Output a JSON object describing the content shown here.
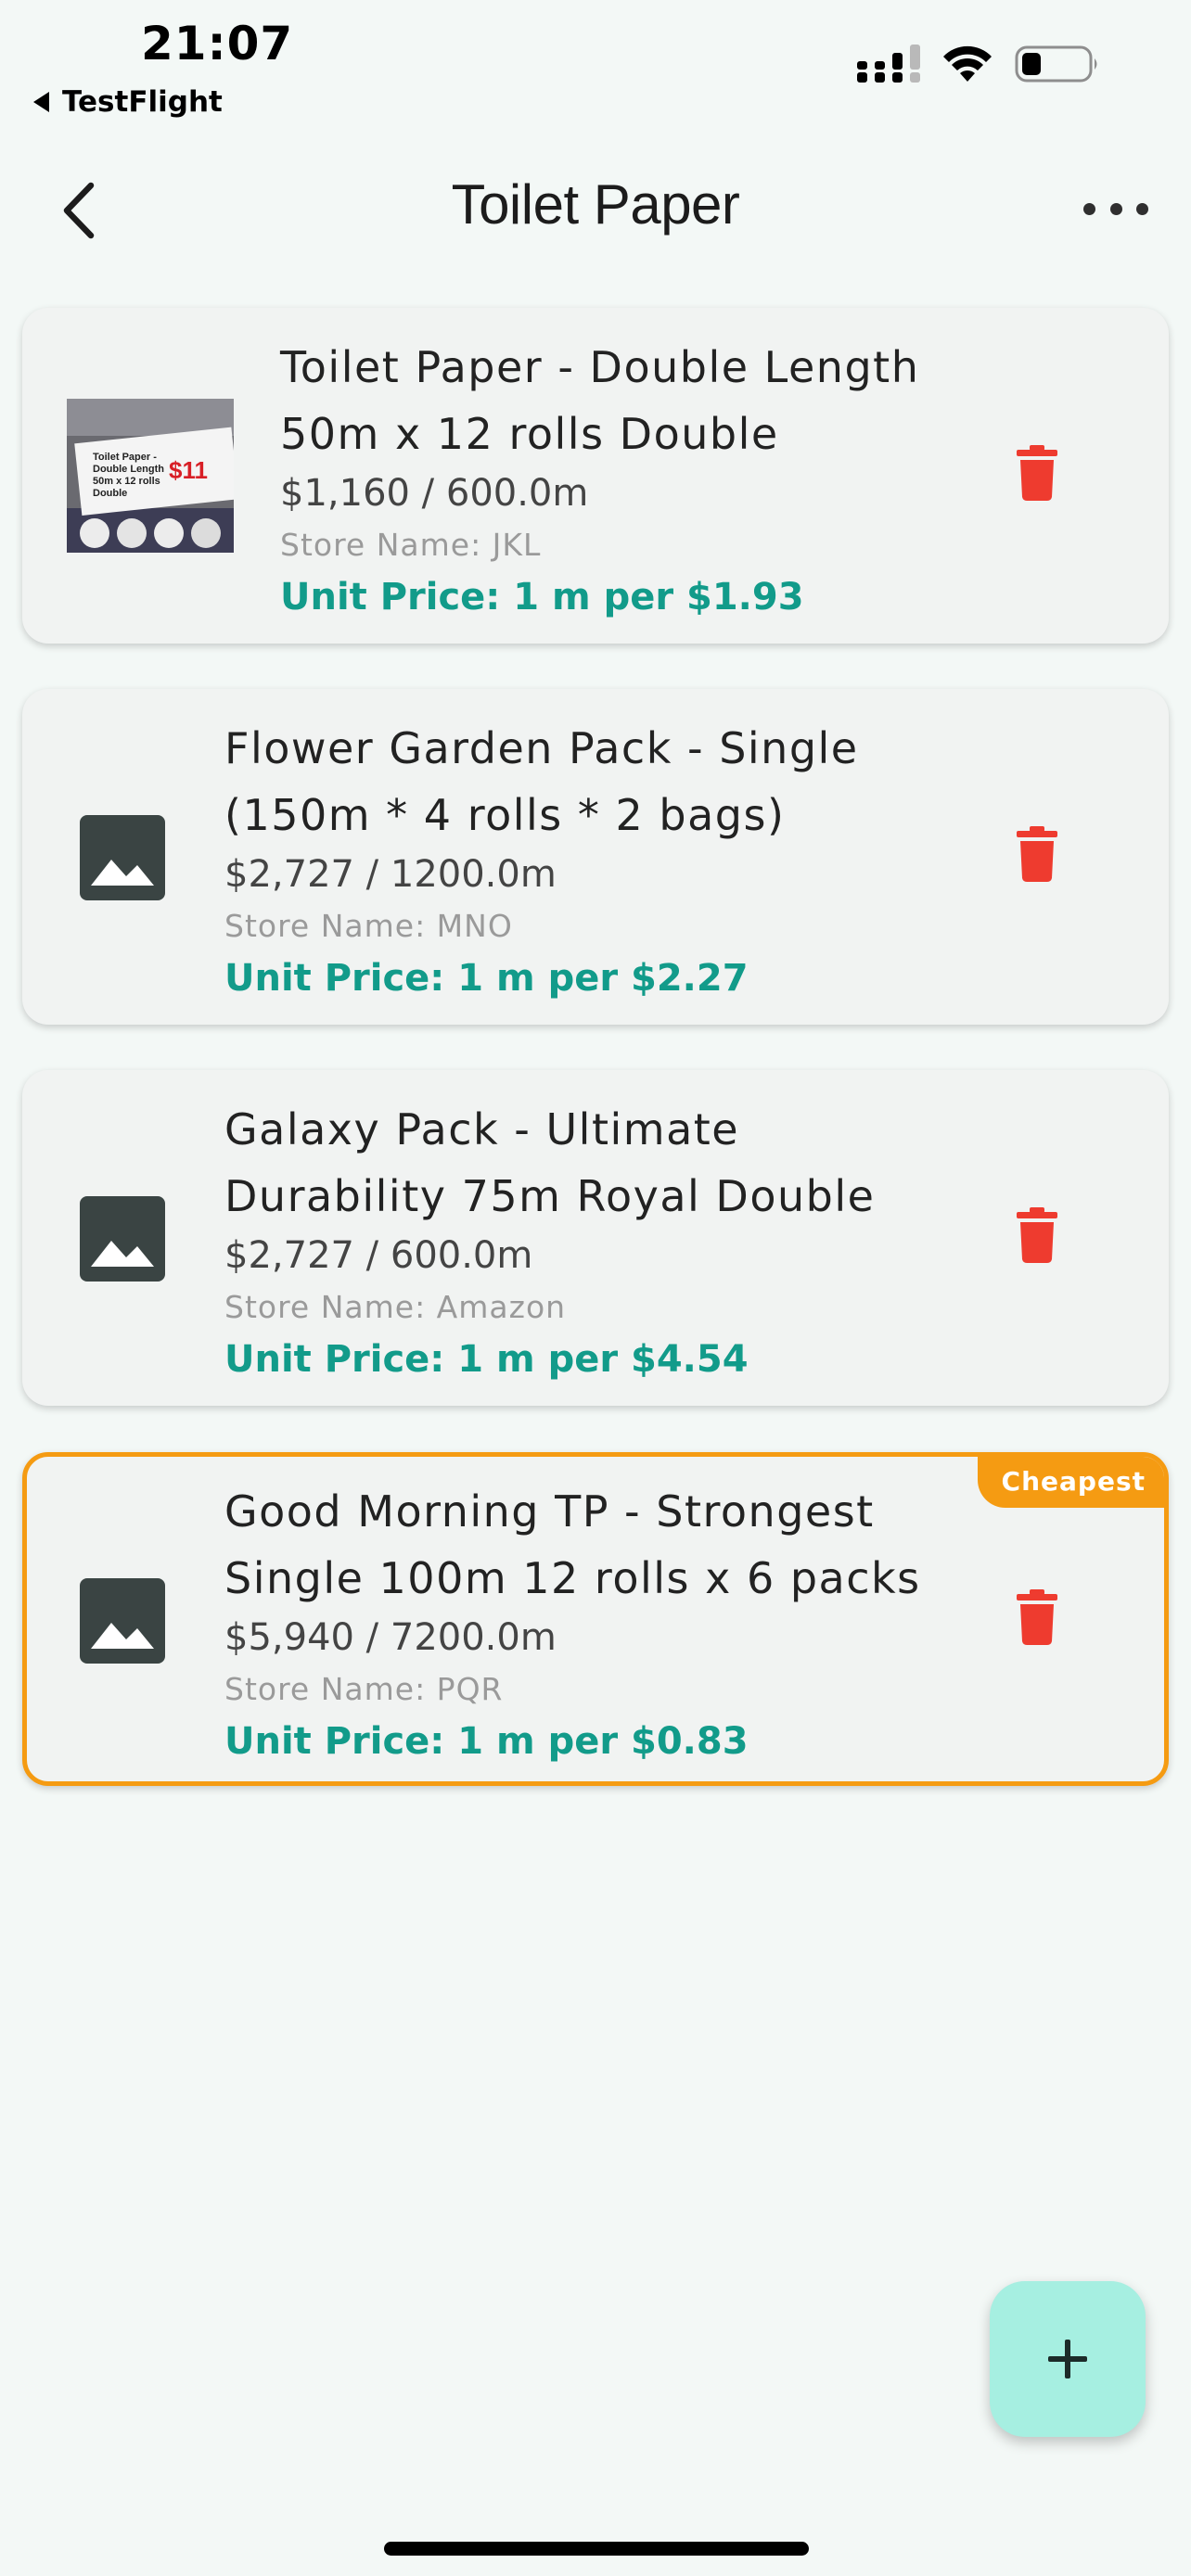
{
  "status_bar": {
    "time": "21:07",
    "back_app": "TestFlight",
    "icons": [
      "signal-icon",
      "wifi-icon",
      "battery-icon"
    ]
  },
  "header": {
    "title": "Toilet Paper",
    "back_icon": "chevron-left-icon",
    "more_icon": "more-horizontal-icon"
  },
  "items": [
    {
      "name_line1": "Toilet Paper - Double Length",
      "name_line2": "50m x 12 rolls Double",
      "price": "$1,160 / 600.0m",
      "store": "Store Name: JKL",
      "unit_price": "Unit Price: 1 m per $1.93",
      "image": "photo",
      "photo_text": [
        "Toilet Paper -",
        "Double Length",
        "50m x 12 rolls",
        "Double"
      ],
      "photo_price": "$11",
      "cheapest": false
    },
    {
      "name_line1": "Flower Garden Pack - Single",
      "name_line2": "(150m * 4 rolls * 2 bags)",
      "price": "$2,727 / 1200.0m",
      "store": "Store Name: MNO",
      "unit_price": "Unit Price: 1 m per $2.27",
      "image": "placeholder",
      "cheapest": false
    },
    {
      "name_line1": "Galaxy Pack - Ultimate",
      "name_line2": "Durability 75m Royal Double",
      "price": "$2,727 / 600.0m",
      "store": "Store Name: Amazon",
      "unit_price": "Unit Price: 1 m per $4.54",
      "image": "placeholder",
      "cheapest": false
    },
    {
      "name_line1": "Good Morning TP - Strongest",
      "name_line2": "Single 100m 12 rolls x 6 packs",
      "price": "$5,940 / 7200.0m",
      "store": "Store Name: PQR",
      "unit_price": "Unit Price: 1 m per $0.83",
      "image": "placeholder",
      "cheapest": true,
      "badge": "Cheapest"
    }
  ],
  "fab": {
    "icon": "plus-icon"
  },
  "colors": {
    "background": "#f3f8f6",
    "card": "#f1f3f2",
    "accent_teal": "#129b8a",
    "delete_red": "#ee3b2f",
    "cheapest_orange": "#f59b12",
    "fab": "#a6efe1"
  }
}
